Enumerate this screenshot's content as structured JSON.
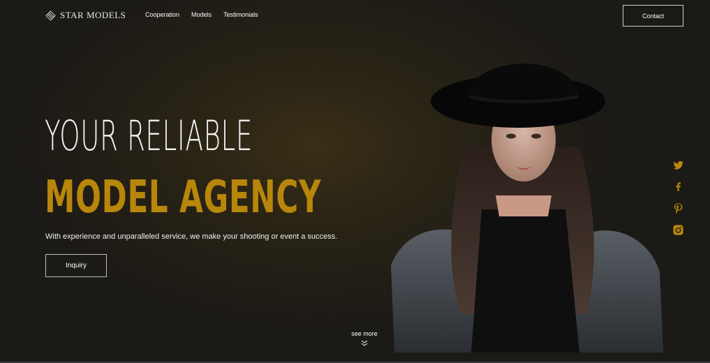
{
  "header": {
    "logo_text": "STAR MODELS",
    "nav": [
      "Cooperation",
      "Models",
      "Testimonials"
    ],
    "contact_label": "Contact"
  },
  "hero": {
    "line1": "YOUR RELIABLE",
    "line2": "MODEL AGENCY",
    "subtitle": "With experience and unparalleled service, we make your shooting or event a success.",
    "inquiry_label": "Inquiry"
  },
  "see_more": {
    "label": "see more",
    "icon": "double-chevron-down-icon"
  },
  "social": [
    "twitter-icon",
    "facebook-icon",
    "pinterest-icon",
    "instagram-icon"
  ],
  "colors": {
    "accent": "#b8860b",
    "background": "#1c1a17"
  }
}
